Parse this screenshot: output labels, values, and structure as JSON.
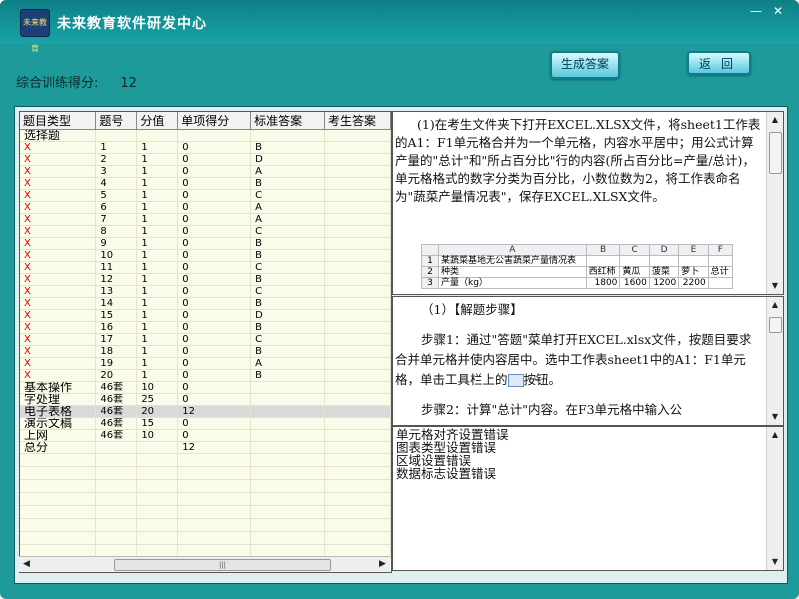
{
  "window": {
    "title": "未来教育软件研发中心",
    "logo_text": "未来教育",
    "minimize_glyph": "—",
    "close_glyph": "✕"
  },
  "score": {
    "label": "综合训练得分:",
    "value": "12"
  },
  "buttons": {
    "generate": "生成答案",
    "back": "返回"
  },
  "grid": {
    "columns": [
      "题目类型",
      "题号",
      "分值",
      "单项得分",
      "标准答案",
      "考生答案"
    ],
    "rows": [
      {
        "type": "选择题",
        "no": "",
        "points": "",
        "score": "",
        "answer": "",
        "student": ""
      },
      {
        "type": "X",
        "no": "1",
        "points": "1",
        "score": "0",
        "answer": "B",
        "student": ""
      },
      {
        "type": "X",
        "no": "2",
        "points": "1",
        "score": "0",
        "answer": "D",
        "student": ""
      },
      {
        "type": "X",
        "no": "3",
        "points": "1",
        "score": "0",
        "answer": "A",
        "student": ""
      },
      {
        "type": "X",
        "no": "4",
        "points": "1",
        "score": "0",
        "answer": "B",
        "student": ""
      },
      {
        "type": "X",
        "no": "5",
        "points": "1",
        "score": "0",
        "answer": "C",
        "student": ""
      },
      {
        "type": "X",
        "no": "6",
        "points": "1",
        "score": "0",
        "answer": "A",
        "student": ""
      },
      {
        "type": "X",
        "no": "7",
        "points": "1",
        "score": "0",
        "answer": "A",
        "student": ""
      },
      {
        "type": "X",
        "no": "8",
        "points": "1",
        "score": "0",
        "answer": "C",
        "student": ""
      },
      {
        "type": "X",
        "no": "9",
        "points": "1",
        "score": "0",
        "answer": "B",
        "student": ""
      },
      {
        "type": "X",
        "no": "10",
        "points": "1",
        "score": "0",
        "answer": "B",
        "student": ""
      },
      {
        "type": "X",
        "no": "11",
        "points": "1",
        "score": "0",
        "answer": "C",
        "student": ""
      },
      {
        "type": "X",
        "no": "12",
        "points": "1",
        "score": "0",
        "answer": "B",
        "student": ""
      },
      {
        "type": "X",
        "no": "13",
        "points": "1",
        "score": "0",
        "answer": "C",
        "student": ""
      },
      {
        "type": "X",
        "no": "14",
        "points": "1",
        "score": "0",
        "answer": "B",
        "student": ""
      },
      {
        "type": "X",
        "no": "15",
        "points": "1",
        "score": "0",
        "answer": "D",
        "student": ""
      },
      {
        "type": "X",
        "no": "16",
        "points": "1",
        "score": "0",
        "answer": "B",
        "student": ""
      },
      {
        "type": "X",
        "no": "17",
        "points": "1",
        "score": "0",
        "answer": "C",
        "student": ""
      },
      {
        "type": "X",
        "no": "18",
        "points": "1",
        "score": "0",
        "answer": "B",
        "student": ""
      },
      {
        "type": "X",
        "no": "19",
        "points": "1",
        "score": "0",
        "answer": "A",
        "student": ""
      },
      {
        "type": "X",
        "no": "20",
        "points": "1",
        "score": "0",
        "answer": "B",
        "student": ""
      },
      {
        "type": "基本操作",
        "no": "46套",
        "points": "10",
        "score": "0",
        "answer": "",
        "student": ""
      },
      {
        "type": "字处理",
        "no": "46套",
        "points": "25",
        "score": "0",
        "answer": "",
        "student": ""
      },
      {
        "type": "电子表格",
        "no": "46套",
        "points": "20",
        "score": "12",
        "answer": "",
        "student": "",
        "selected": true
      },
      {
        "type": "演示文稿",
        "no": "46套",
        "points": "15",
        "score": "0",
        "answer": "",
        "student": ""
      },
      {
        "type": "上网",
        "no": "46套",
        "points": "10",
        "score": "0",
        "answer": "",
        "student": ""
      },
      {
        "type": "总分",
        "no": "",
        "points": "",
        "score": "12",
        "answer": "",
        "student": ""
      }
    ],
    "empty_rows": 8,
    "scroll_thumb_glyph": "|||"
  },
  "question": {
    "text": "(1)在考生文件夹下打开EXCEL.XLSX文件，将sheet1工作表的A1：F1单元格合并为一个单元格，内容水平居中；用公式计算产量的\"总计\"和\"所占百分比\"行的内容(所占百分比=产量/总计)，单元格格式的数字分类为百分比，小数位数为2，将工作表命名为\"蔬菜产量情况表\"，保存EXCEL.XLSX文件。",
    "sheet": {
      "col_headers": [
        "A",
        "B",
        "C",
        "D",
        "E",
        "F"
      ],
      "rows": [
        {
          "n": "1",
          "cells": [
            "某蔬菜基地无公害蔬菜产量情况表",
            "",
            "",
            "",
            "",
            ""
          ]
        },
        {
          "n": "2",
          "cells": [
            "种类",
            "西红柿",
            "黄瓜",
            "菠菜",
            "萝卜",
            "总计"
          ]
        },
        {
          "n": "3",
          "cells": [
            "产量（kg）",
            "1800",
            "1600",
            "1200",
            "2200",
            ""
          ]
        }
      ]
    }
  },
  "steps": {
    "heading": "（1）【解题步骤】",
    "step1_before": "步骤1：通过\"答题\"菜单打开EXCEL.xlsx文件，按题目要求合并单元格并使内容居中。选中工作表sheet1中的A1：F1单元格，单击工具栏上的",
    "step1_after": "按钮。",
    "step2": "步骤2：计算\"总计\"内容。在F3单元格中输入公"
  },
  "errors": [
    "单元格对齐设置错误",
    "图表类型设置错误",
    "区域设置错误",
    "数据标志设置错误"
  ],
  "colors": {
    "window_bg": "#1e9a9a",
    "grid_bg": "#fbfbe9",
    "wrong_mark": "#e00000"
  }
}
